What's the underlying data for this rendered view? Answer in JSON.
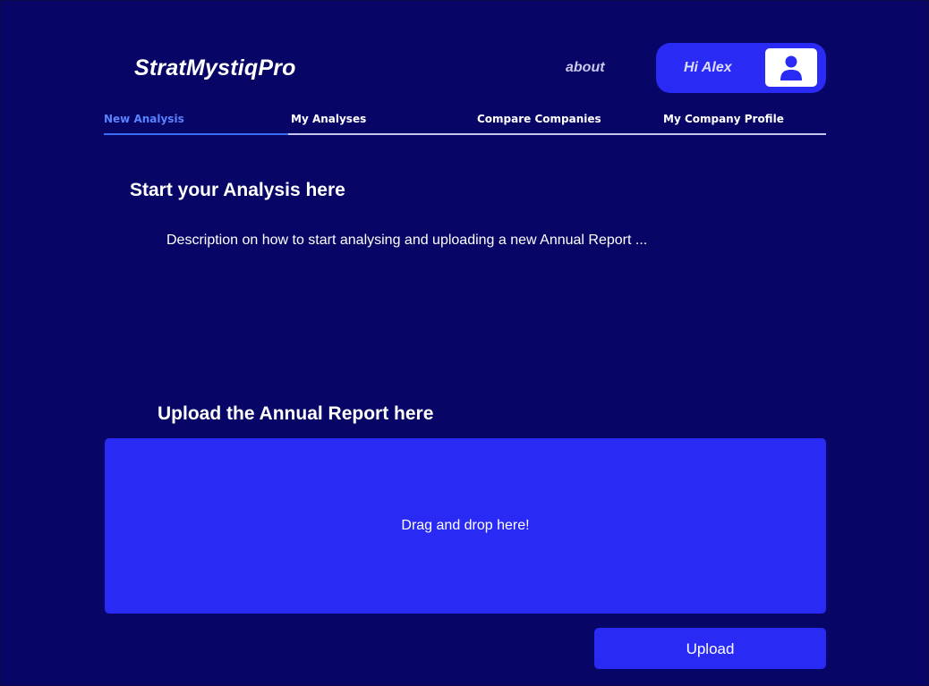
{
  "header": {
    "logo": "StratMystiqPro",
    "about_label": "about",
    "user_greeting": "Hi Alex",
    "avatar_icon": "user-icon"
  },
  "tabs": [
    {
      "label": "New Analysis",
      "active": true
    },
    {
      "label": "My Analyses",
      "active": false
    },
    {
      "label": "Compare Companies",
      "active": false
    },
    {
      "label": "My Company Profile",
      "active": false
    }
  ],
  "main": {
    "start_title": "Start your Analysis here",
    "description": "Description on how to start analysing and uploading a new Annual Report ...",
    "upload_title": "Upload the Annual Report here",
    "dropzone_text": "Drag and drop here!",
    "upload_button": "Upload"
  },
  "colors": {
    "background": "#070565",
    "accent": "#2a2af5",
    "active_tab": "#5a83ff"
  }
}
